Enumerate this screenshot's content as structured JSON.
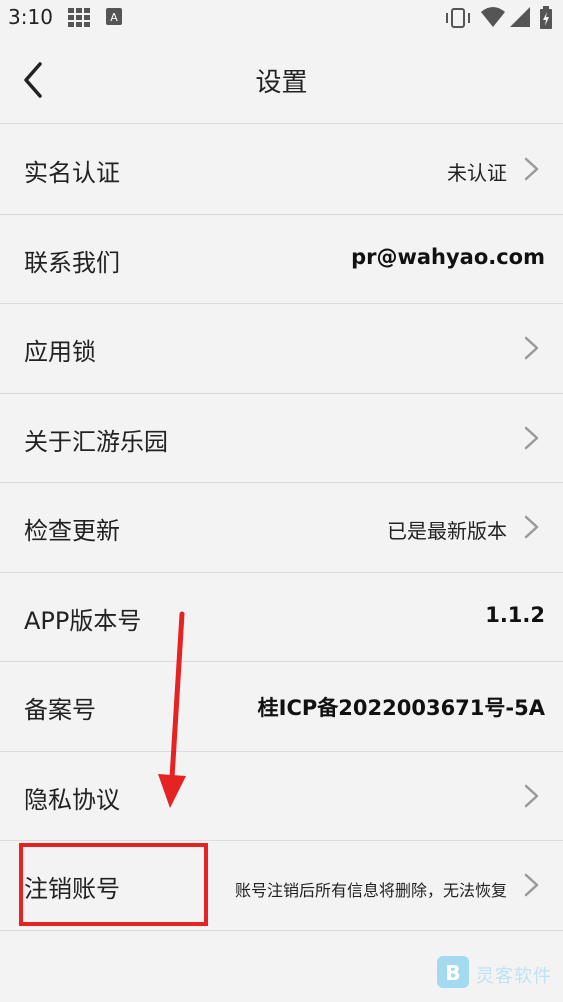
{
  "status_bar": {
    "time": "3:10"
  },
  "header": {
    "title": "设置"
  },
  "rows": [
    {
      "label": "实名认证",
      "value": "未认证",
      "chevron": true
    },
    {
      "label": "联系我们",
      "value": "pr@wahyao.com",
      "chevron": false
    },
    {
      "label": "应用锁",
      "value": "",
      "chevron": true
    },
    {
      "label": "关于汇游乐园",
      "value": "",
      "chevron": true
    },
    {
      "label": "检查更新",
      "value": "已是最新版本",
      "chevron": true
    },
    {
      "label": "APP版本号",
      "value": "1.1.2",
      "chevron": false
    },
    {
      "label": "备案号",
      "value": "桂ICP备2022003671号-5A",
      "chevron": false
    },
    {
      "label": "隐私协议",
      "value": "",
      "chevron": true
    },
    {
      "label": "注销账号",
      "value": "账号注销后所有信息将删除，无法恢复",
      "chevron": true
    }
  ],
  "watermark": {
    "text": "灵客软件"
  },
  "colors": {
    "annotation_red": "#e52323",
    "background": "#f3f3f3",
    "divider": "#dcdcdc"
  }
}
